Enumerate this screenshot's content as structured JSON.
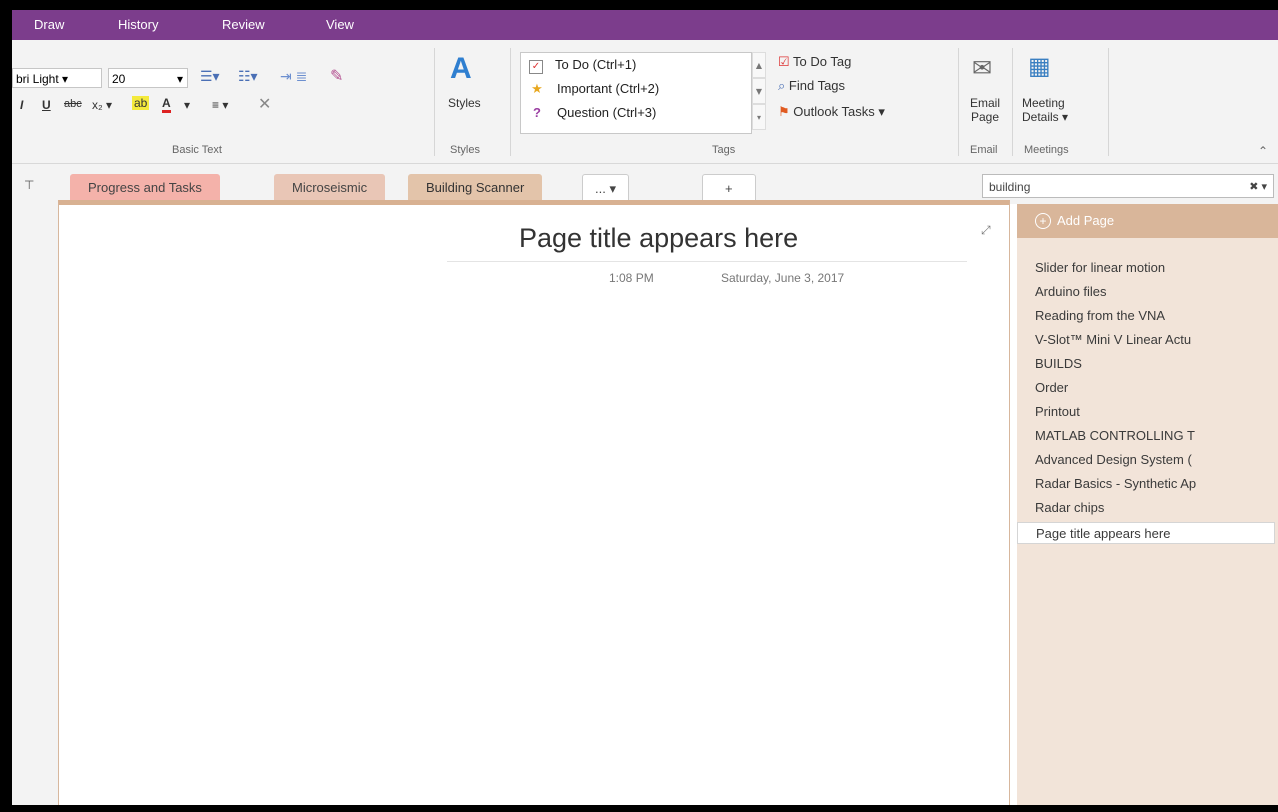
{
  "menu": {
    "tabs": [
      "Draw",
      "History",
      "Review",
      "View"
    ]
  },
  "ribbon": {
    "font_name": "bri Light",
    "font_size": "20",
    "basic_text_label": "Basic Text",
    "styles_label": "Styles",
    "styles_button": "Styles",
    "tags_label": "Tags",
    "tags": [
      {
        "label": "To Do (Ctrl+1)",
        "icon": "checkbox-icon"
      },
      {
        "label": "Important (Ctrl+2)",
        "icon": "star-icon"
      },
      {
        "label": "Question (Ctrl+3)",
        "icon": "question-icon"
      }
    ],
    "todo_tag": "To Do Tag",
    "find_tags": "Find Tags",
    "outlook_tasks": "Outlook Tasks",
    "email_line1": "Email",
    "email_line2": "Page",
    "email_label": "Email",
    "meeting_line1": "Meeting",
    "meeting_line2": "Details",
    "meetings_label": "Meetings"
  },
  "sections": {
    "tabs": [
      "Progress and Tasks",
      "Microseismic",
      "Building Scanner",
      "... ▾",
      "+"
    ],
    "colors": [
      "#f4b2aa",
      "#e9c6b6",
      "#e3c4aa",
      "#f3f3f3",
      "#f3f3f3"
    ]
  },
  "search": {
    "value": "building",
    "clear": "✖ ▾"
  },
  "page": {
    "title": "Page title appears here",
    "time": "1:08 PM",
    "date": "Saturday, June 3, 2017"
  },
  "pages": {
    "add_label": "Add Page",
    "items": [
      "Slider for linear motion",
      "Arduino files",
      "Reading from the VNA",
      "V-Slot™ Mini V Linear Actu",
      "BUILDS",
      "Order",
      "Printout",
      "MATLAB CONTROLLING T",
      "Advanced Design System (",
      "Radar Basics - Synthetic Ap",
      "Radar chips",
      "Page title appears here"
    ],
    "selected_index": 11
  },
  "colors": {
    "menubar": "#7c3d8c",
    "section_accent": "#d9b69a",
    "page_panel": "#f2e4d9"
  }
}
